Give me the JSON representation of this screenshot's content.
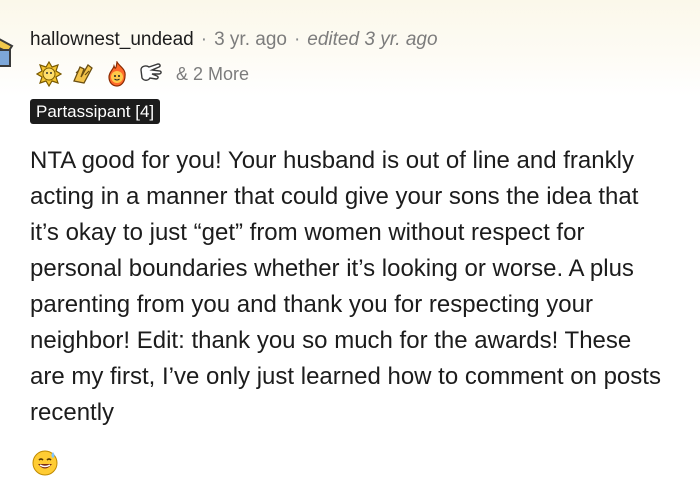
{
  "comment": {
    "author": "hallownest_undead",
    "separator": "·",
    "time": "3 yr. ago",
    "edited": "edited 3 yr. ago",
    "awards_more": "& 2 More",
    "flair": "Partassipant [4]",
    "text": "NTA good for you! Your husband is out of line and frankly acting in a manner that could give your sons the idea that it’s okay to just “get” from women without respect for personal boundaries whether it’s looking or worse. A plus parenting from you and thank you for respecting your neighbor! Edit: thank you so much for the awards! These are my first, I’ve only just learned how to comment on posts recently",
    "award_icons": [
      "gold-medal-icon",
      "praise-hands-icon",
      "fire-face-icon",
      "pointing-hand-icon"
    ],
    "trailing_emoji": "grinning-sweat-emoji"
  },
  "colors": {
    "text": "#1c1c1c",
    "meta": "#7c7c7c",
    "flair_bg": "#1c1c1c",
    "flair_text": "#ffffff",
    "header_tint": "#fbf8ea"
  }
}
